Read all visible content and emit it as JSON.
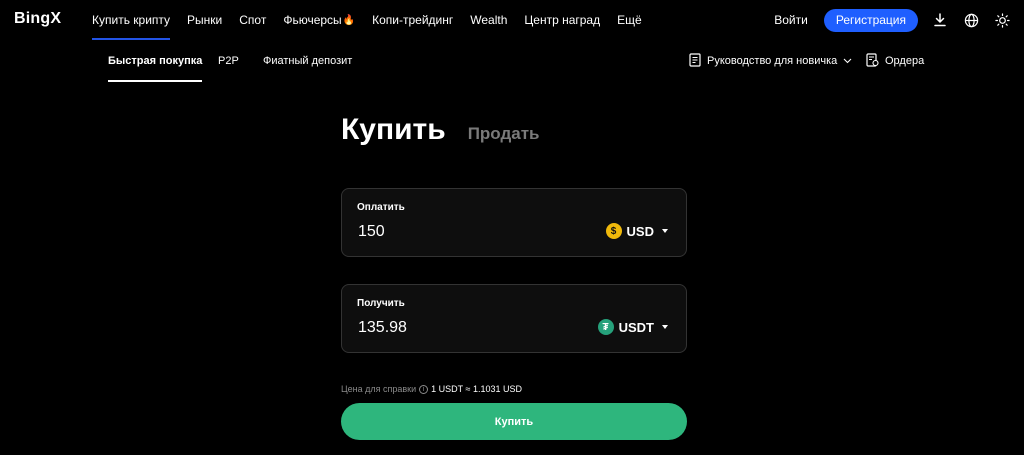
{
  "brand": {
    "logo": "BingX"
  },
  "nav": {
    "items": [
      {
        "label": "Купить крипту",
        "active": true
      },
      {
        "label": "Рынки"
      },
      {
        "label": "Спот"
      },
      {
        "label": "Фьючерсы",
        "badge": "🔥"
      },
      {
        "label": "Копи-трейдинг"
      },
      {
        "label": "Wealth"
      },
      {
        "label": "Центр наград"
      },
      {
        "label": "Ещё"
      }
    ],
    "login": "Войти",
    "register": "Регистрация",
    "icons": [
      "download-icon",
      "globe-icon",
      "theme-icon"
    ]
  },
  "subnav": {
    "tabs": [
      {
        "label": "Быстрая покупка",
        "active": true
      },
      {
        "label": "P2P"
      },
      {
        "label": "Фиатный депозит"
      }
    ],
    "guide": "Руководство для новичка",
    "orders": "Ордера"
  },
  "trade": {
    "buy_tab": "Купить",
    "sell_tab": "Продать",
    "pay": {
      "label": "Оплатить",
      "amount": "150",
      "currency": "USD",
      "icon": "usd-coin-icon"
    },
    "receive": {
      "label": "Получить",
      "amount": "135.98",
      "currency": "USDT",
      "icon": "usdt-coin-icon"
    },
    "reference": {
      "label": "Цена для справки",
      "value": "1 USDT ≈ 1.1031 USD"
    },
    "button": "Купить"
  },
  "colors": {
    "accent": "#1f5fff",
    "buy": "#2eb67d",
    "usd": "#f0b90b",
    "usdt": "#26a17b"
  }
}
